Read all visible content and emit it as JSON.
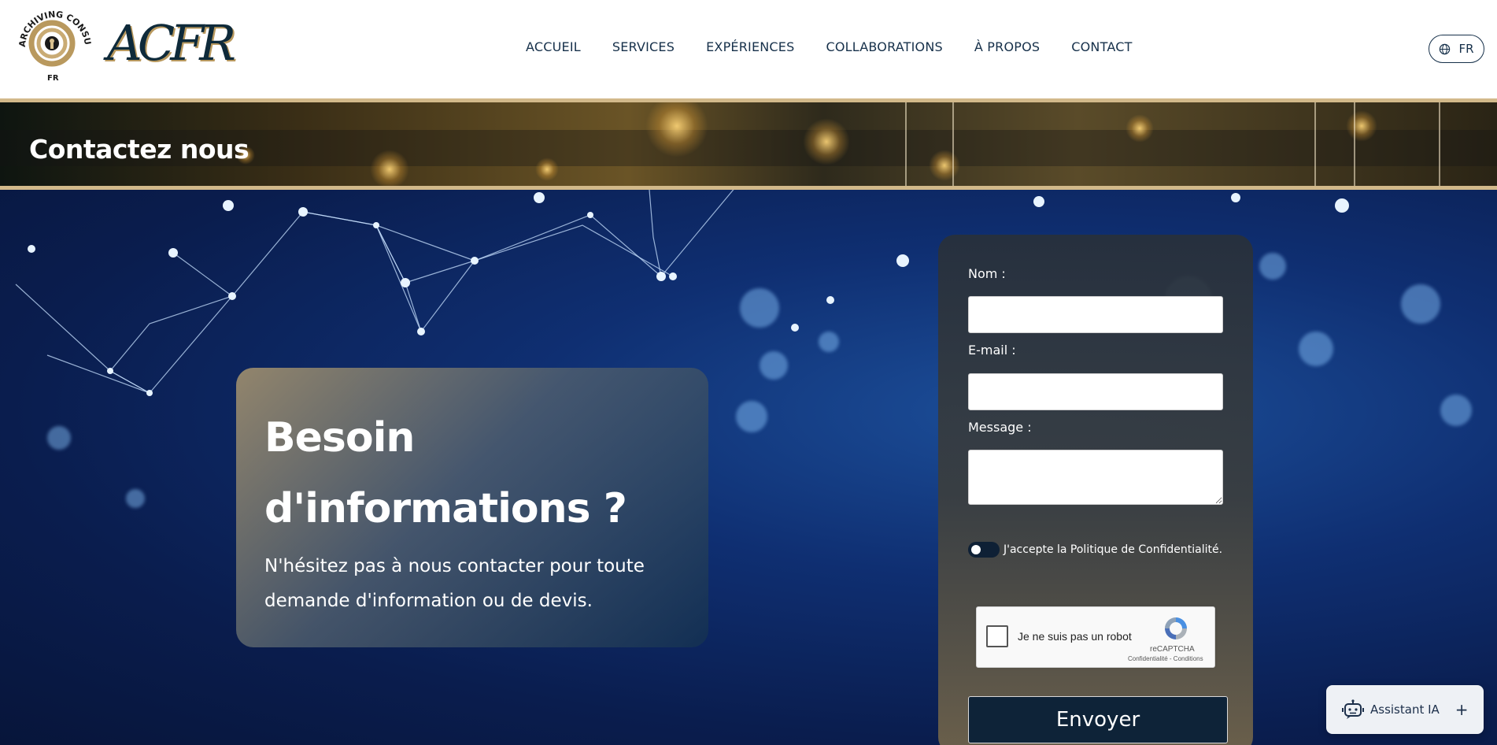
{
  "header": {
    "logo_seal_text_top": "ARCHIVING CONSULTING",
    "logo_seal_text_bottom": "FR",
    "logo_text": "ACFR",
    "nav": [
      "ACCUEIL",
      "SERVICES",
      "EXPÉRIENCES",
      "COLLABORATIONS",
      "À PROPOS",
      "CONTACT"
    ],
    "language": "FR"
  },
  "banner": {
    "title": "Contactez nous"
  },
  "info": {
    "title_line1": "Besoin",
    "title_line2": "d'informations ?",
    "text": "N'hésitez pas à nous contacter pour toute demande d'information ou de devis."
  },
  "form": {
    "name_label": "Nom :",
    "name_value": "",
    "email_label": "E-mail :",
    "email_value": "",
    "message_label": "Message :",
    "message_value": "",
    "privacy_label": "J'accepte la Politique de Confidentialité.",
    "recaptcha_label": "Je ne suis pas un robot",
    "recaptcha_brand": "reCAPTCHA",
    "recaptcha_terms": "Confidentialité - Conditions",
    "submit_label": "Envoyer"
  },
  "assistant": {
    "label": "Assistant IA",
    "plus": "+"
  },
  "colors": {
    "navy": "#0e2338",
    "gold": "#d2b98a",
    "hero_blue": "#0f2f72"
  },
  "icons": {
    "language": "globe-icon",
    "assistant": "robot-icon",
    "recaptcha": "recaptcha-logo-icon"
  }
}
